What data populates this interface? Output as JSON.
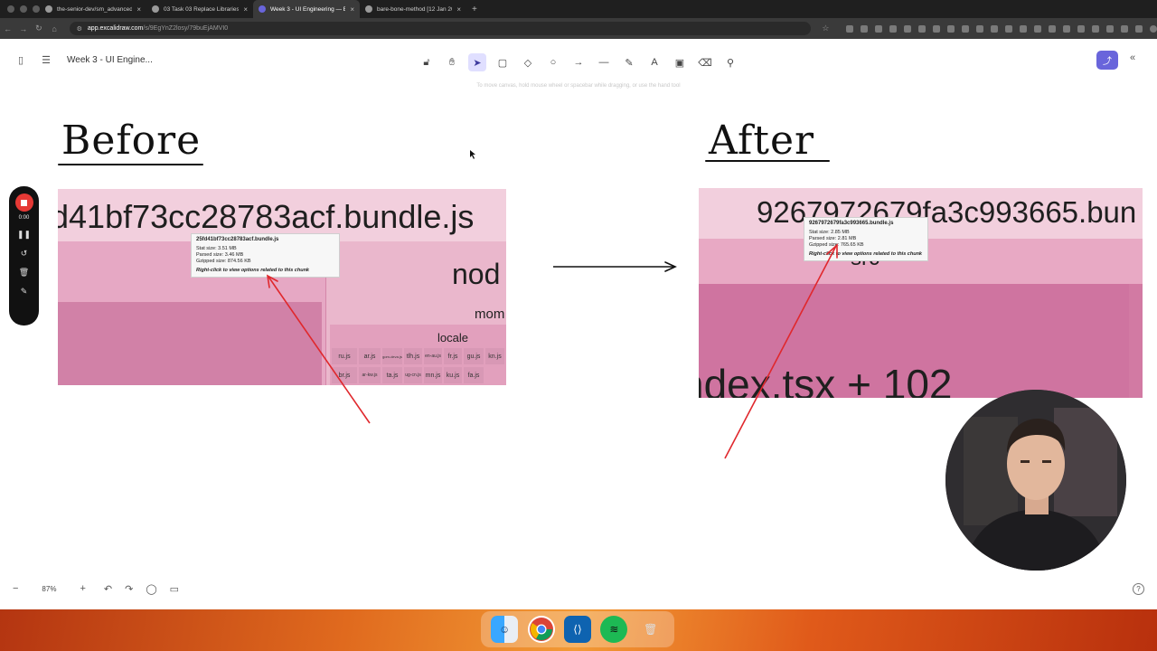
{
  "browser": {
    "tabs": [
      {
        "title": "the-senior-dev/sm_advanced-fron",
        "active": false
      },
      {
        "title": "03 Task 03 Replace Libraries with",
        "active": false
      },
      {
        "title": "Week 3 - UI Engineering — Exc",
        "active": true
      },
      {
        "title": "bare-bone-method [12 Jan 2025]",
        "active": false
      }
    ],
    "url_host": "app.excalidraw.com",
    "url_path": "/s/9EgYnZ2losy/79buEjAMVI0"
  },
  "app": {
    "doc_title": "Week 3 - UI Engine...",
    "canvas_hint": "To move canvas, hold mouse wheel or spacebar while dragging, or use the hand tool",
    "tools": [
      "lock-icon",
      "hand-icon",
      "selection-icon",
      "rectangle-icon",
      "diamond-icon",
      "ellipse-icon",
      "arrow-icon",
      "line-icon",
      "pencil-icon",
      "text-icon",
      "image-icon",
      "eraser-icon",
      "extra-tools-icon"
    ],
    "selected_tool": "selection-icon",
    "zoom": "87%",
    "accent_color": "#6965db"
  },
  "recorder": {
    "time": "0:00"
  },
  "canvas": {
    "before_title": "Before",
    "after_title": "After",
    "before_shot": {
      "bundle_name": "d41bf73cc28783acf.bundle.js",
      "nod_label": "nod",
      "mom_label": "mom",
      "locale_label": "locale",
      "files": [
        "ru.js",
        "ar.js",
        "gom-deva.js",
        "tlh.js",
        "en-au.js",
        "fr.js",
        "gu.js",
        "kn.js",
        "br.js",
        "ar-kw.js",
        "ta.js",
        "ug-cn.js",
        "mn.js",
        "ku.js",
        "fa.js"
      ],
      "tooltip": {
        "title": "25fd41bf73cc28783acf.bundle.js",
        "stat": "Stat size: 3.51 MB",
        "parsed": "Parsed size: 3.46 MB",
        "gzipped": "Gzipped size: 874.56 KB",
        "hint": "Right-click to view options related to this chunk"
      }
    },
    "after_shot": {
      "bundle_name": "9267972679fa3c993665.bun",
      "src_label": "src",
      "index_label": "ndex.tsx + 102",
      "tooltip": {
        "title": "9267972679fa3c993665.bundle.js",
        "stat": "Stat size: 2.85 MB",
        "parsed": "Parsed size: 2.81 MB",
        "gzipped": "Gzipped size: 765.65 KB",
        "hint": "Right-click to view options related to this chunk"
      }
    }
  }
}
